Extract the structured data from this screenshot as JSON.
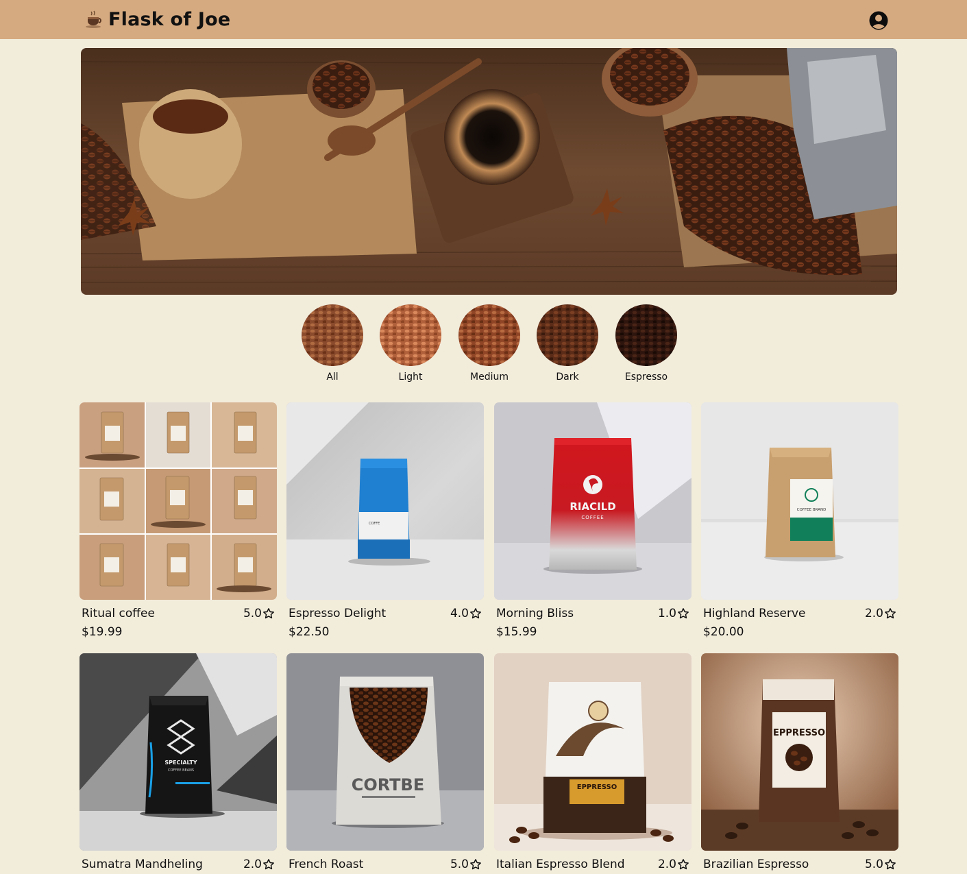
{
  "header": {
    "title": "Flask of Joe",
    "logo_icon": "coffee-cup-icon",
    "account_icon": "user-circle-icon"
  },
  "hero": {
    "image": "coffee-beans-hero-image"
  },
  "roast_filters": [
    {
      "label": "All",
      "color": "#8a4a2c"
    },
    {
      "label": "Light",
      "color": "#b0603a"
    },
    {
      "label": "Medium",
      "color": "#8f4526"
    },
    {
      "label": "Dark",
      "color": "#5b2c18"
    },
    {
      "label": "Espresso",
      "color": "#2e150d"
    }
  ],
  "products": [
    {
      "name": "Ritual coffee",
      "rating": "5.0",
      "price": "$19.99",
      "image": "grid-of-bags"
    },
    {
      "name": "Espresso Delight",
      "rating": "4.0",
      "price": "$22.50",
      "image": "blue-bag",
      "bag_label": "COFFE"
    },
    {
      "name": "Morning Bliss",
      "rating": "1.0",
      "price": "$15.99",
      "image": "red-bag",
      "bag_label": "RIACILD",
      "bag_sub": "COFFEE"
    },
    {
      "name": "Highland Reserve",
      "rating": "2.0",
      "price": "$20.00",
      "image": "kraft-green-bag",
      "bag_label": "COFFEE BRAND"
    },
    {
      "name": "Sumatra Mandheling",
      "rating": "2.0",
      "price": "",
      "image": "black-bag",
      "bag_label": "SPECIALTY",
      "bag_sub": "COFFEE BEANS"
    },
    {
      "name": "French Roast",
      "rating": "5.0",
      "price": "",
      "image": "white-bag-window",
      "bag_label": "CORTBE"
    },
    {
      "name": "Italian Espresso Blend",
      "rating": "2.0",
      "price": "",
      "image": "wave-bag",
      "bag_label": "EPPRESSO"
    },
    {
      "name": "Brazilian Espresso",
      "rating": "5.0",
      "price": "",
      "image": "brown-bag",
      "bag_label": "EPPRESSO"
    }
  ],
  "colors": {
    "header_bg": "#d6aa80",
    "page_bg": "#f2ecdb"
  }
}
